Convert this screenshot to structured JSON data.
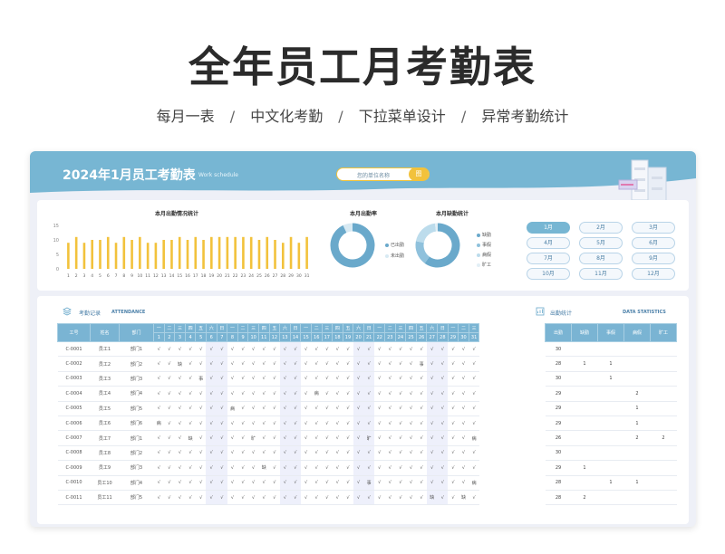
{
  "hero": {
    "title": "全年员工月考勤表",
    "features": [
      "每月一表",
      "中文化考勤",
      "下拉菜单设计",
      "异常考勤统计"
    ],
    "separator": "/"
  },
  "banner": {
    "title": "2024年1月员工考勤表",
    "subtitle": "Work schedule",
    "unit_label": "您的单位名称",
    "unit_badge": "图"
  },
  "colors": {
    "accent": "#77b6d3",
    "bar": "#f2c23c",
    "weekend": "#eef0fb"
  },
  "charts": {
    "daily_title": "本月出勤情况统计",
    "rate_title": "本月出勤率",
    "absence_title": "本月缺勤统计",
    "rate_legend": [
      "已出勤",
      "未出勤"
    ],
    "absence_legend": [
      "缺勤",
      "事假",
      "病假",
      "旷工"
    ]
  },
  "chart_data": [
    {
      "type": "bar",
      "title": "本月出勤情况统计",
      "categories": [
        "1",
        "2",
        "3",
        "4",
        "5",
        "6",
        "7",
        "8",
        "9",
        "10",
        "11",
        "12",
        "13",
        "14",
        "15",
        "16",
        "17",
        "18",
        "19",
        "20",
        "21",
        "22",
        "23",
        "24",
        "25",
        "26",
        "27",
        "28",
        "29",
        "30",
        "31"
      ],
      "values": [
        9,
        11,
        9,
        10,
        10,
        11,
        9,
        11,
        10,
        11,
        9,
        9,
        10,
        10,
        11,
        10,
        11,
        10,
        11,
        11,
        11,
        11,
        11,
        11,
        10,
        11,
        10,
        9,
        11,
        9,
        11
      ],
      "ylim": [
        0,
        15
      ],
      "yticks": [
        "15",
        "10",
        "5",
        "0"
      ]
    },
    {
      "type": "pie",
      "title": "本月出勤率",
      "labels": [
        "已出勤",
        "未出勤"
      ],
      "values": [
        0.93,
        0.07
      ]
    },
    {
      "type": "pie",
      "title": "本月缺勤统计",
      "labels": [
        "缺勤",
        "事假",
        "病假",
        "旷工"
      ],
      "values": [
        0.6,
        0.18,
        0.2,
        0.02
      ]
    }
  ],
  "months": [
    "1月",
    "2月",
    "3月",
    "4月",
    "5月",
    "6月",
    "7月",
    "8月",
    "9月",
    "10月",
    "11月",
    "12月"
  ],
  "active_month": "1月",
  "attendance": {
    "section_title": "考勤记录",
    "section_en": "ATTENDANCE",
    "col_id": "工号",
    "col_name": "姓名",
    "col_dept": "部门",
    "weekdays": [
      "一",
      "二",
      "三",
      "四",
      "五",
      "六",
      "日",
      "一",
      "二",
      "三",
      "四",
      "五",
      "六",
      "日",
      "一",
      "二",
      "三",
      "四",
      "五",
      "六",
      "日",
      "一",
      "二",
      "三",
      "四",
      "五",
      "六",
      "日",
      "一",
      "二",
      "三"
    ],
    "days": [
      "1",
      "2",
      "3",
      "4",
      "5",
      "6",
      "7",
      "8",
      "9",
      "10",
      "11",
      "12",
      "13",
      "14",
      "15",
      "16",
      "17",
      "18",
      "19",
      "20",
      "21",
      "22",
      "23",
      "24",
      "25",
      "26",
      "27",
      "28",
      "29",
      "30",
      "31"
    ],
    "weekend_days": [
      6,
      7,
      13,
      14,
      20,
      21,
      27,
      28
    ],
    "rows": [
      {
        "id": "C-0001",
        "name": "员工1",
        "dept": "部门1",
        "marks": [
          "√",
          "√",
          "√",
          "√",
          "√",
          "√",
          "√",
          "√",
          "√",
          "√",
          "√",
          "√",
          "√",
          "√",
          "√",
          "√",
          "√",
          "√",
          "√",
          "√",
          "√",
          "√",
          "√",
          "√",
          "√",
          "√",
          "√",
          "√",
          "√",
          "√",
          "√"
        ]
      },
      {
        "id": "C-0002",
        "name": "员工2",
        "dept": "部门2",
        "marks": [
          "√",
          "√",
          "缺",
          "√",
          "√",
          "√",
          "√",
          "√",
          "√",
          "√",
          "√",
          "√",
          "√",
          "√",
          "√",
          "√",
          "√",
          "√",
          "√",
          "√",
          "√",
          "√",
          "√",
          "√",
          "√",
          "事",
          "√",
          "√",
          "√",
          "√",
          "√"
        ]
      },
      {
        "id": "C-0003",
        "name": "员工3",
        "dept": "部门3",
        "marks": [
          "√",
          "√",
          "√",
          "√",
          "事",
          "√",
          "√",
          "√",
          "√",
          "√",
          "√",
          "√",
          "√",
          "√",
          "√",
          "√",
          "√",
          "√",
          "√",
          "√",
          "√",
          "√",
          "√",
          "√",
          "√",
          "√",
          "√",
          "√",
          "√",
          "√",
          "√"
        ]
      },
      {
        "id": "C-0004",
        "name": "员工4",
        "dept": "部门4",
        "marks": [
          "√",
          "√",
          "√",
          "√",
          "√",
          "√",
          "√",
          "√",
          "√",
          "√",
          "√",
          "√",
          "√",
          "√",
          "√",
          "病",
          "√",
          "√",
          "√",
          "√",
          "√",
          "√",
          "√",
          "√",
          "√",
          "√",
          "√",
          "√",
          "√",
          "√",
          "√"
        ]
      },
      {
        "id": "C-0005",
        "name": "员工5",
        "dept": "部门5",
        "marks": [
          "√",
          "√",
          "√",
          "√",
          "√",
          "√",
          "√",
          "病",
          "√",
          "√",
          "√",
          "√",
          "√",
          "√",
          "√",
          "√",
          "√",
          "√",
          "√",
          "√",
          "√",
          "√",
          "√",
          "√",
          "√",
          "√",
          "√",
          "√",
          "√",
          "√",
          "√"
        ]
      },
      {
        "id": "C-0006",
        "name": "员工6",
        "dept": "部门6",
        "marks": [
          "病",
          "√",
          "√",
          "√",
          "√",
          "√",
          "√",
          "√",
          "√",
          "√",
          "√",
          "√",
          "√",
          "√",
          "√",
          "√",
          "√",
          "√",
          "√",
          "√",
          "√",
          "√",
          "√",
          "√",
          "√",
          "√",
          "√",
          "√",
          "√",
          "√",
          "√"
        ]
      },
      {
        "id": "C-0007",
        "name": "员工7",
        "dept": "部门1",
        "marks": [
          "√",
          "√",
          "√",
          "缺",
          "√",
          "√",
          "√",
          "√",
          "√",
          "旷",
          "√",
          "√",
          "√",
          "√",
          "√",
          "√",
          "√",
          "√",
          "√",
          "√",
          "旷",
          "√",
          "√",
          "√",
          "√",
          "√",
          "√",
          "√",
          "√",
          "√",
          "病"
        ]
      },
      {
        "id": "C-0008",
        "name": "员工8",
        "dept": "部门2",
        "marks": [
          "√",
          "√",
          "√",
          "√",
          "√",
          "√",
          "√",
          "√",
          "√",
          "√",
          "√",
          "√",
          "√",
          "√",
          "√",
          "√",
          "√",
          "√",
          "√",
          "√",
          "√",
          "√",
          "√",
          "√",
          "√",
          "√",
          "√",
          "√",
          "√",
          "√",
          "√"
        ]
      },
      {
        "id": "C-0009",
        "name": "员工9",
        "dept": "部门3",
        "marks": [
          "√",
          "√",
          "√",
          "√",
          "√",
          "√",
          "√",
          "√",
          "√",
          "√",
          "缺",
          "√",
          "√",
          "√",
          "√",
          "√",
          "√",
          "√",
          "√",
          "√",
          "√",
          "√",
          "√",
          "√",
          "√",
          "√",
          "√",
          "√",
          "√",
          "√",
          "√"
        ]
      },
      {
        "id": "C-0010",
        "name": "员工10",
        "dept": "部门4",
        "marks": [
          "√",
          "√",
          "√",
          "√",
          "√",
          "√",
          "√",
          "√",
          "√",
          "√",
          "√",
          "√",
          "√",
          "√",
          "√",
          "√",
          "√",
          "√",
          "√",
          "√",
          "事",
          "√",
          "√",
          "√",
          "√",
          "√",
          "√",
          "√",
          "√",
          "√",
          "病"
        ]
      },
      {
        "id": "C-0011",
        "name": "员工11",
        "dept": "部门5",
        "marks": [
          "√",
          "√",
          "√",
          "√",
          "√",
          "√",
          "√",
          "√",
          "√",
          "√",
          "√",
          "√",
          "√",
          "√",
          "√",
          "√",
          "√",
          "√",
          "√",
          "√",
          "√",
          "√",
          "√",
          "√",
          "√",
          "√",
          "缺",
          "√",
          "√",
          "缺",
          "√"
        ]
      }
    ]
  },
  "stats": {
    "section_title": "出勤统计",
    "section_en": "DATA STATISTICS",
    "headers": [
      "出勤",
      "缺勤",
      "事假",
      "病假",
      "旷工"
    ],
    "rows": [
      [
        "30",
        "",
        "",
        "",
        ""
      ],
      [
        "28",
        "1",
        "1",
        "",
        ""
      ],
      [
        "30",
        "",
        "1",
        "",
        ""
      ],
      [
        "29",
        "",
        "",
        "2",
        ""
      ],
      [
        "29",
        "",
        "",
        "1",
        ""
      ],
      [
        "29",
        "",
        "",
        "1",
        ""
      ],
      [
        "26",
        "",
        "",
        "2",
        "2"
      ],
      [
        "30",
        "",
        "",
        "",
        ""
      ],
      [
        "29",
        "1",
        "",
        "",
        ""
      ],
      [
        "28",
        "",
        "1",
        "1",
        ""
      ],
      [
        "28",
        "2",
        "",
        "",
        ""
      ]
    ]
  }
}
